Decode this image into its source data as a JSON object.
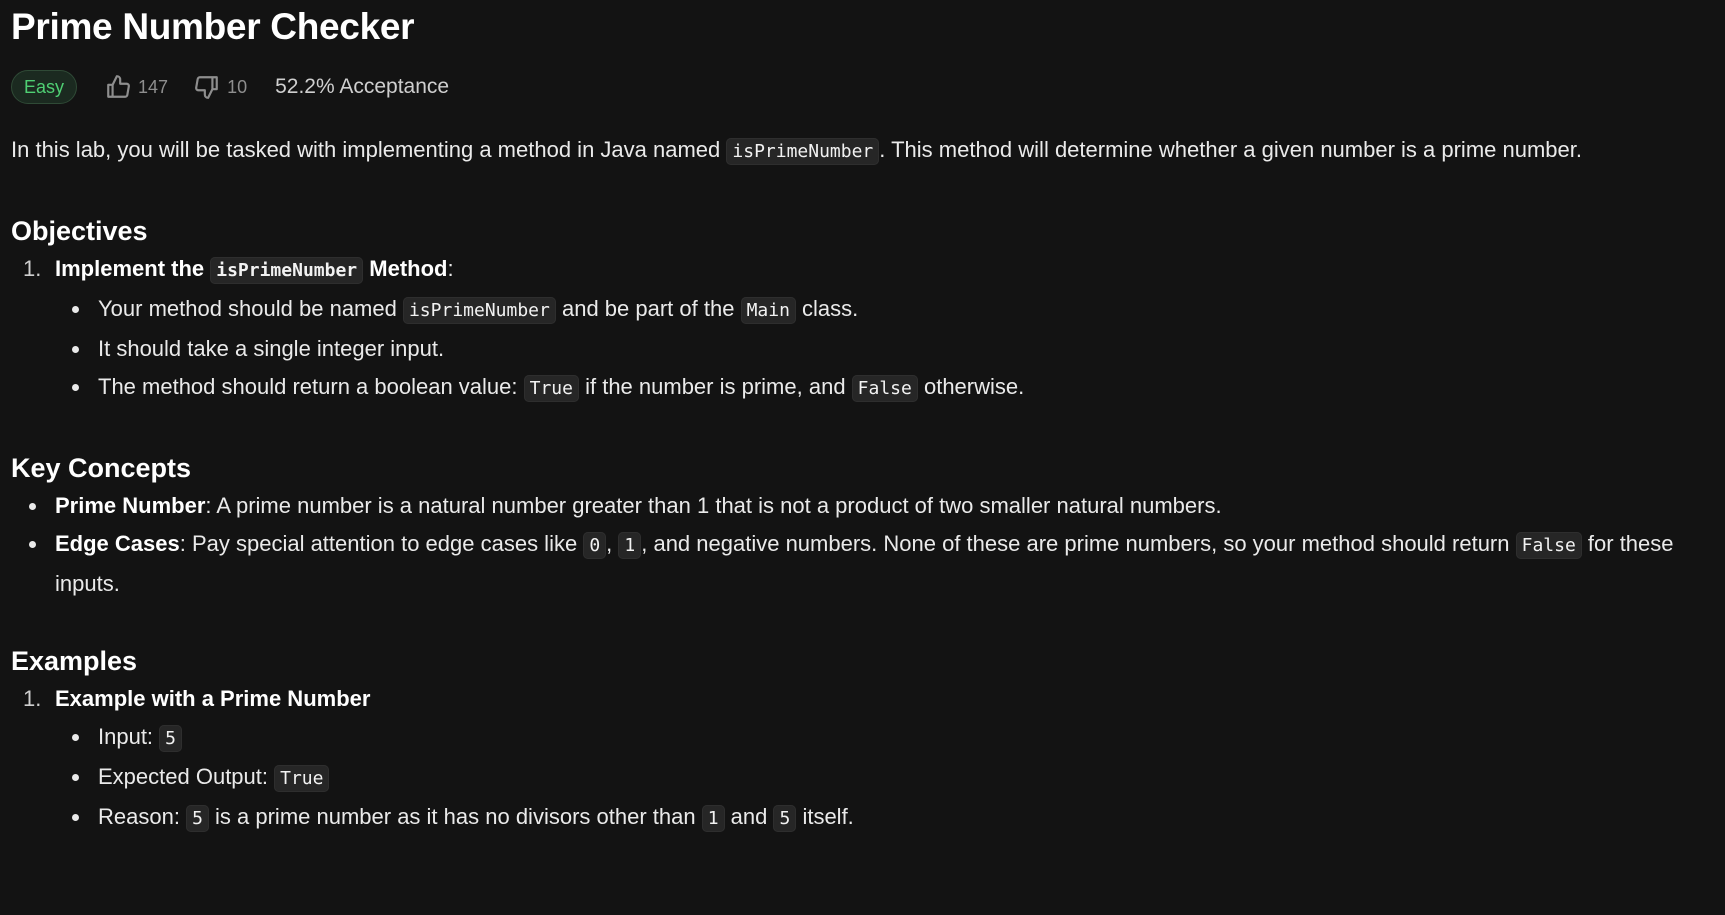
{
  "title": "Prime Number Checker",
  "difficulty": "Easy",
  "likes": "147",
  "dislikes": "10",
  "acceptance": "52.2% Acceptance",
  "intro": {
    "before": "In this lab, you will be tasked with implementing a method in Java named ",
    "code": "isPrimeNumber",
    "after": ". This method will determine whether a given number is a prime number."
  },
  "objectives": {
    "heading": "Objectives",
    "items": [
      {
        "num": "1.",
        "head_before": "Implement the ",
        "head_code": "isPrimeNumber",
        "head_after": " Method",
        "head_suffix": ":",
        "bullets": [
          {
            "t1": "Your method should be named ",
            "c1": "isPrimeNumber",
            "t2": " and be part of the ",
            "c2": "Main",
            "t3": " class."
          },
          {
            "t1": "It should take a single integer input."
          },
          {
            "t1": "The method should return a boolean value: ",
            "c1": "True",
            "t2": " if the number is prime, and ",
            "c2": "False",
            "t3": " otherwise."
          }
        ]
      }
    ]
  },
  "key_concepts": {
    "heading": "Key Concepts",
    "items": [
      {
        "term": "Prime Number",
        "desc": ": A prime number is a natural number greater than 1 that is not a product of two smaller natural numbers."
      },
      {
        "term": "Edge Cases",
        "t1": ": Pay special attention to edge cases like ",
        "c1": "0",
        "t2": ", ",
        "c2": "1",
        "t3": ", and negative numbers. None of these are prime numbers, so your method should return ",
        "c3": "False",
        "t4": " for these inputs."
      }
    ]
  },
  "examples": {
    "heading": "Examples",
    "items": [
      {
        "num": "1.",
        "head": "Example with a Prime Number",
        "input_label": "Input: ",
        "input_value": "5",
        "output_label": "Expected Output: ",
        "output_value": "True",
        "reason_label": "Reason: ",
        "reason_c1": "5",
        "reason_t1": " is a prime number as it has no divisors other than ",
        "reason_c2": "1",
        "reason_t2": " and ",
        "reason_c3": "5",
        "reason_t3": " itself."
      }
    ]
  },
  "icons": {
    "like": "thumbs-up-icon",
    "dislike": "thumbs-down-icon"
  },
  "colors": {
    "background": "#131313",
    "easy_badge_text": "#4fcf73",
    "easy_badge_bg": "#1b2a20"
  }
}
